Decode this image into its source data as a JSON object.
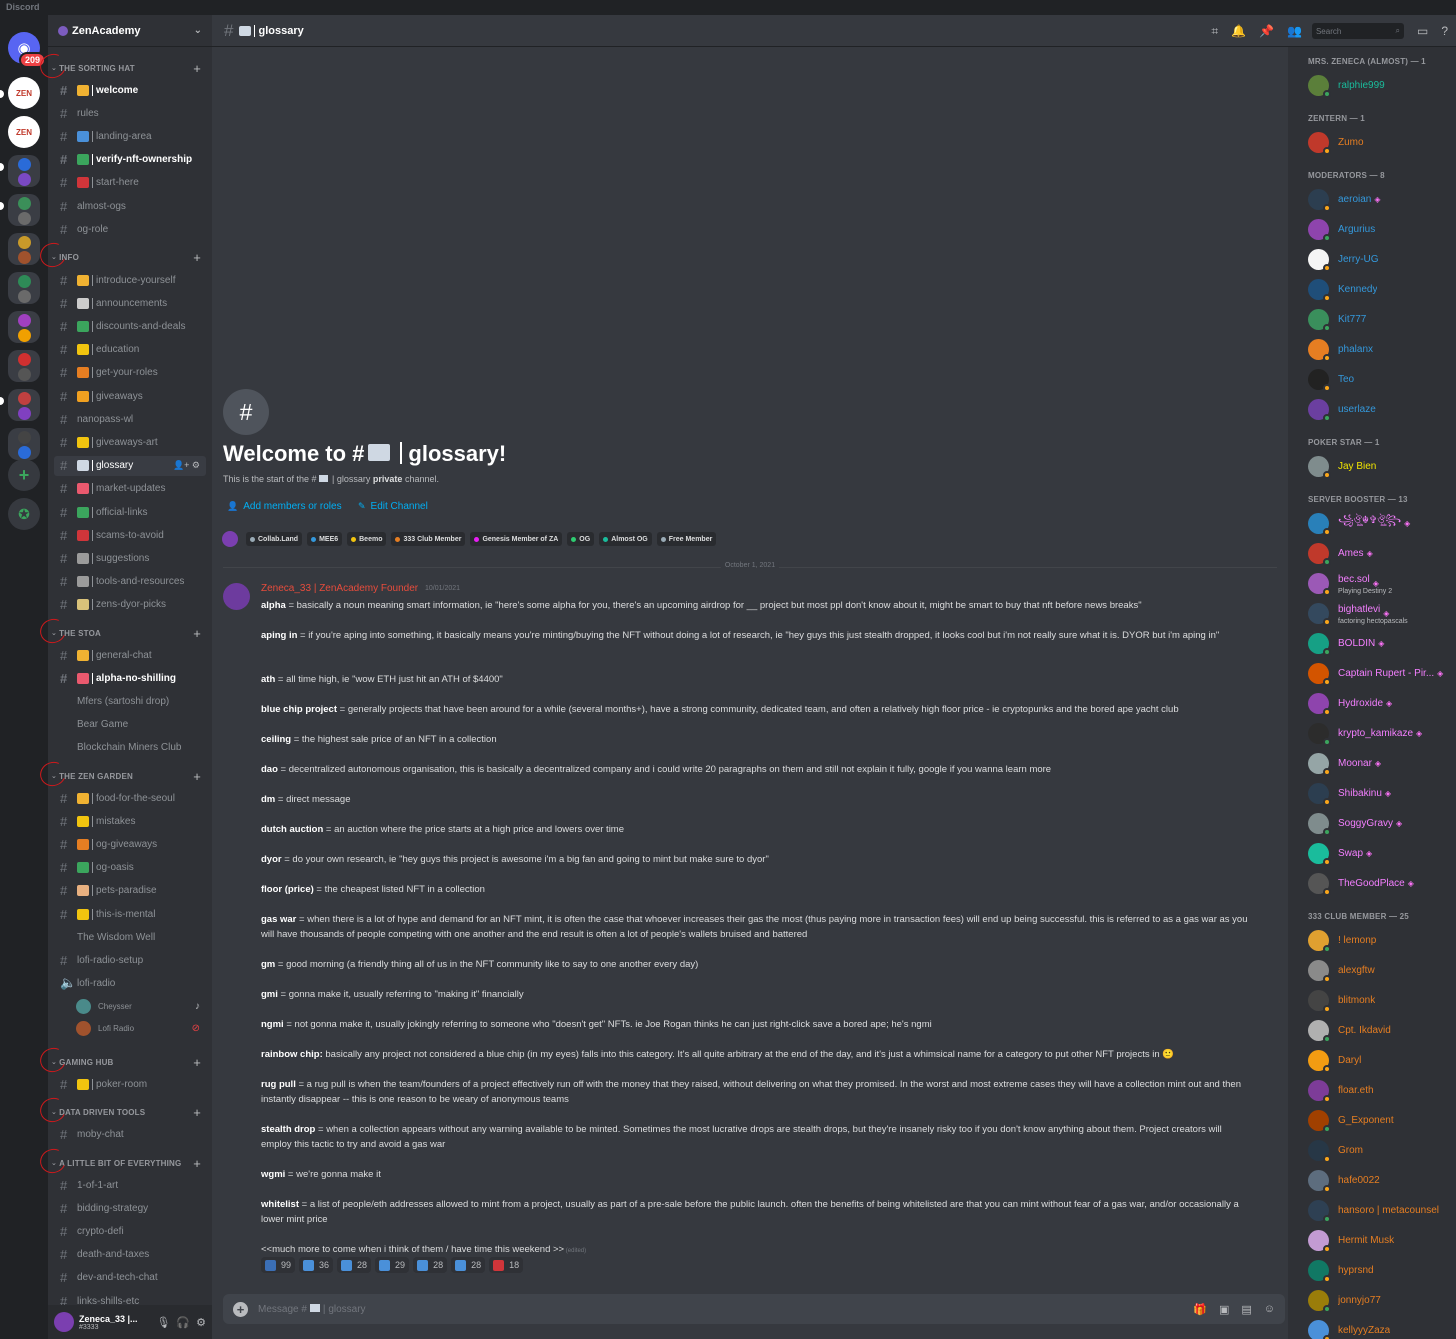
{
  "app": {
    "title": "Discord"
  },
  "servers": {
    "mention_badge": "209"
  },
  "guild": {
    "name": "ZenAcademy"
  },
  "categories": [
    {
      "name": "THE SORTING HAT"
    },
    {
      "name": "INFO"
    },
    {
      "name": "THE STOA"
    },
    {
      "name": "THE ZEN GARDEN"
    },
    {
      "name": "GAMING HUB"
    },
    {
      "name": "DATA DRIVEN TOOLS"
    },
    {
      "name": "A LITTLE BIT OF EVERYTHING"
    }
  ],
  "channels": {
    "sorting": [
      "welcome",
      "rules",
      "landing-area",
      "verify-nft-ownership",
      "start-here",
      "almost-ogs",
      "og-role"
    ],
    "info": [
      "introduce-yourself",
      "announcements",
      "discounts-and-deals",
      "education",
      "get-your-roles",
      "giveaways",
      "nanopass-wl",
      "giveaways-art",
      "glossary",
      "market-updates",
      "official-links",
      "scams-to-avoid",
      "suggestions",
      "tools-and-resources",
      "zens-dyor-picks"
    ],
    "stoa": [
      "general-chat",
      "alpha-no-shilling"
    ],
    "stoa_threads": [
      "Mfers (sartoshi drop)",
      "Bear Game",
      "Blockchain Miners Club"
    ],
    "garden": [
      "food-for-the-seoul",
      "mistakes",
      "og-giveaways",
      "og-oasis",
      "pets-paradise",
      "this-is-mental"
    ],
    "garden_thread": "The Wisdom Well",
    "garden_tail": [
      "lofi-radio-setup",
      "lofi-radio"
    ],
    "voice_users": [
      "Cheysser",
      "Lofi Radio"
    ],
    "gaming": [
      "poker-room"
    ],
    "data": [
      "moby-chat"
    ],
    "everything": [
      "1-of-1-art",
      "bidding-strategy",
      "crypto-defi",
      "death-and-taxes",
      "dev-and-tech-chat",
      "links-shills-etc"
    ]
  },
  "user": {
    "name": "Zeneca_33 |...",
    "tag": "#3333"
  },
  "header": {
    "channel": "glossary",
    "search_placeholder": "Search"
  },
  "welcome": {
    "title_prefix": "Welcome to #",
    "title_name": "glossary!",
    "sub_prefix": "This is the start of the #",
    "sub_name": "glossary",
    "sub_private": "private",
    "sub_suffix": "channel.",
    "add_members": "Add members or roles",
    "edit_channel": "Edit Channel"
  },
  "roles": [
    {
      "name": "Collab.Land",
      "color": "#99aab5"
    },
    {
      "name": "MEE6",
      "color": "#3498db"
    },
    {
      "name": "Beemo",
      "color": "#f1c40f"
    },
    {
      "name": "333 Club Member",
      "color": "#e67e22"
    },
    {
      "name": "Genesis Member of ZA",
      "color": "#e91ef5"
    },
    {
      "name": "OG",
      "color": "#2ecc71"
    },
    {
      "name": "Almost OG",
      "color": "#1abc9c"
    },
    {
      "name": "Free Member",
      "color": "#99aab5"
    }
  ],
  "date_divider": "October 1, 2021",
  "message": {
    "author": "Zeneca_33 | ZenAcademy Founder",
    "timestamp": "10/01/2021",
    "entries": [
      {
        "term": "alpha",
        "text": " = basically a noun meaning smart information, ie \"here's some alpha for you, there's an upcoming airdrop for __ project but most ppl don't know about it, might be smart to buy that nft before news breaks\""
      },
      {
        "term": "aping in",
        "text": " = if you're aping into something, it basically means you're minting/buying the NFT without doing a lot of research, ie \"hey guys this just stealth dropped, it looks cool but i'm not really sure what it is. DYOR but i'm aping in\""
      },
      {
        "term": "ath",
        "text": " = all time high, ie \"wow ETH just hit an ATH of $4400\""
      },
      {
        "term": "blue chip project",
        "text": " = generally projects that have been around for a while (several months+), have a strong community, dedicated team, and often a relatively high floor price - ie cryptopunks and the bored ape yacht club"
      },
      {
        "term": "ceiling",
        "text": " = the highest sale price of an NFT in a collection"
      },
      {
        "term": "dao",
        "text": " = decentralized autonomous organisation, this is basically a decentralized company and i could write 20 paragraphs on them and still not explain it fully, google if you wanna learn more"
      },
      {
        "term": "dm",
        "text": " = direct message"
      },
      {
        "term": "dutch auction",
        "text": " = an auction where the price starts at a high price and lowers over time"
      },
      {
        "term": "dyor",
        "text": " = do your own research, ie \"hey guys this project is awesome i'm a big fan and going to mint but make sure to dyor\""
      },
      {
        "term": "floor (price)",
        "text": " = the cheapest listed NFT in a collection"
      },
      {
        "term": "gas war",
        "text": " = when there is a lot of hype and demand for an NFT mint, it is often the case that whoever increases their gas the most (thus paying more in transaction fees) will end up being successful. this is referred to as a gas war as you will have thousands of people competing with one another and the end result is often a lot of people's wallets bruised and battered"
      },
      {
        "term": "gm",
        "text": " = good morning (a friendly thing all of us in the NFT community like to say to one another every day)"
      },
      {
        "term": "gmi",
        "text": " = gonna make it, usually referring to \"making it\" financially"
      },
      {
        "term": "ngmi",
        "text": " = not gonna make it, usually jokingly referring to someone who \"doesn't get\" NFTs. ie Joe Rogan thinks he can just right-click save a bored ape; he's ngmi"
      },
      {
        "term": "rainbow chip:",
        "text": " basically any project not considered a blue chip (in my eyes) falls into this category. It's all quite arbitrary at the end of the day, and it's just a whimsical name for a category to put other NFT projects in 🙂"
      },
      {
        "term": "rug pull",
        "text": " = a rug pull is when the team/founders of a project effectively run off with the money that they raised, without delivering on what they promised. In the worst and most extreme cases they will have a collection mint out and then instantly disappear -- this is one reason to be weary of anonymous teams"
      },
      {
        "term": "stealth drop",
        "text": " = when a collection appears without any warning available to be minted. Sometimes the most lucrative drops are stealth drops, but they're insanely risky too if you don't know anything about them. Project creators will employ this tactic to try and avoid a gas war"
      },
      {
        "term": "wgmi",
        "text": " = we're gonna make it"
      },
      {
        "term": "whitelist",
        "text": " = a list of people/eth addresses allowed to mint from a project, usually as part of a pre-sale before the public launch. often the benefits of being whitelisted are that you can mint without fear of a gas war, and/or occasionally a lower mint price"
      }
    ],
    "closing": "<<much more to come when i think of them / have time this weekend >>",
    "edited": "(edited)"
  },
  "reactions": [
    {
      "count": "99",
      "color": "#3b6fb6"
    },
    {
      "count": "36",
      "color": "#4a90d9"
    },
    {
      "count": "28",
      "color": "#4a90d9"
    },
    {
      "count": "29",
      "color": "#4a90d9"
    },
    {
      "count": "28",
      "color": "#4a90d9"
    },
    {
      "count": "28",
      "color": "#4a90d9"
    },
    {
      "count": "18",
      "color": "#d0353a"
    }
  ],
  "composer": {
    "placeholder_prefix": "Message #",
    "placeholder_name": "glossary"
  },
  "member_groups": [
    {
      "header": "MRS. ZENECA (ALMOST) — 1",
      "members": [
        {
          "name": "ralphie999",
          "color": "#1abc9c"
        }
      ]
    },
    {
      "header": "ZENTERN — 1",
      "members": [
        {
          "name": "Zumo",
          "color": "#e67e22"
        }
      ]
    },
    {
      "header": "MODERATORS — 8",
      "members": [
        {
          "name": "aeroian",
          "color": "#3498db",
          "gem": true
        },
        {
          "name": "Argurius",
          "color": "#3498db"
        },
        {
          "name": "Jerry-UG",
          "color": "#3498db"
        },
        {
          "name": "Kennedy",
          "color": "#3498db"
        },
        {
          "name": "Kit777",
          "color": "#3498db"
        },
        {
          "name": "phalanx",
          "color": "#3498db"
        },
        {
          "name": "Teo",
          "color": "#3498db"
        },
        {
          "name": "userlaze",
          "color": "#3498db"
        }
      ]
    },
    {
      "header": "POKER STAR — 1",
      "members": [
        {
          "name": "Jay Bien",
          "color": "#f1e500"
        }
      ]
    },
    {
      "header": "SERVER BOOSTER — 13",
      "members": [
        {
          "name": "꧁ঔৣ☬✞ঔৣ꧂",
          "color": "#f47fff",
          "gem": true
        },
        {
          "name": "Ames",
          "color": "#f47fff",
          "gem": true
        },
        {
          "name": "bec.sol",
          "color": "#f47fff",
          "gem": true,
          "sub": "Playing Destiny 2"
        },
        {
          "name": "bighatlevi",
          "color": "#f47fff",
          "gem": true,
          "sub": "factoring hectopascals"
        },
        {
          "name": "BOLDIN",
          "color": "#f47fff",
          "gem": true
        },
        {
          "name": "Captain Rupert - Pir...",
          "color": "#f47fff",
          "gem": true
        },
        {
          "name": "Hydroxide",
          "color": "#f47fff",
          "gem": true
        },
        {
          "name": "krypto_kamikaze",
          "color": "#f47fff",
          "gem": true
        },
        {
          "name": "Moonar",
          "color": "#f47fff",
          "gem": true
        },
        {
          "name": "Shibakinu",
          "color": "#f47fff",
          "gem": true
        },
        {
          "name": "SoggyGravy",
          "color": "#f47fff",
          "gem": true
        },
        {
          "name": "Swap",
          "color": "#f47fff",
          "gem": true
        },
        {
          "name": "TheGoodPlace",
          "color": "#f47fff",
          "gem": true
        }
      ]
    },
    {
      "header": "333 CLUB MEMBER — 25",
      "members": [
        {
          "name": "! lemonp",
          "color": "#e67e22"
        },
        {
          "name": "alexgftw",
          "color": "#e67e22"
        },
        {
          "name": "blitmonk",
          "color": "#e67e22"
        },
        {
          "name": "Cpt. Ikdavid",
          "color": "#e67e22"
        },
        {
          "name": "Daryl",
          "color": "#e67e22"
        },
        {
          "name": "floar.eth",
          "color": "#e67e22"
        },
        {
          "name": "G_Exponent",
          "color": "#e67e22"
        },
        {
          "name": "Grom",
          "color": "#e67e22"
        },
        {
          "name": "hafe0022",
          "color": "#e67e22"
        },
        {
          "name": "hansoro | metacounsel",
          "color": "#e67e22"
        },
        {
          "name": "Hermit Musk",
          "color": "#e67e22"
        },
        {
          "name": "hyprsnd",
          "color": "#e67e22"
        },
        {
          "name": "jonnyjo77",
          "color": "#e67e22"
        },
        {
          "name": "kellyyyZaza",
          "color": "#e67e22"
        }
      ]
    }
  ]
}
